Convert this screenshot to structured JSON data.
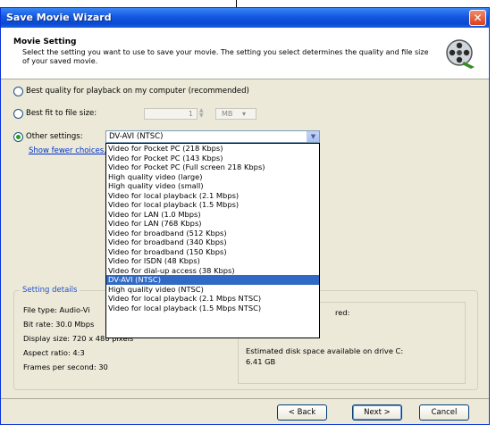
{
  "window": {
    "title": "Save Movie Wizard",
    "close_symbol": "✕"
  },
  "header": {
    "title": "Movie Setting",
    "description": "Select the setting you want to use to save your movie. The setting you select determines the quality and file size of your saved movie."
  },
  "options": {
    "best_quality_label": "Best quality for playback on my computer (recommended)",
    "best_fit_label": "Best fit to file size:",
    "file_size_value": "1",
    "file_size_unit": "MB",
    "other_settings_label": "Other settings:",
    "other_settings_value": "DV-AVI (NTSC)",
    "show_fewer": "Show fewer choices..."
  },
  "dropdown": {
    "items": [
      "Video for Pocket PC (218 Kbps)",
      "Video for Pocket PC (143 Kbps)",
      "Video for Pocket PC (Full screen 218 Kbps)",
      "High quality video (large)",
      "High quality video (small)",
      "Video for local playback (2.1 Mbps)",
      "Video for local playback (1.5 Mbps)",
      "Video for LAN (1.0 Mbps)",
      "Video for LAN (768 Kbps)",
      "Video for broadband (512 Kbps)",
      "Video for broadband (340 Kbps)",
      "Video for broadband (150 Kbps)",
      "Video for ISDN (48 Kbps)",
      "Video for dial-up access (38 Kbps)",
      "DV-AVI (NTSC)",
      "High quality video (NTSC)",
      "Video for local playback (2.1 Mbps NTSC)",
      "Video for local playback (1.5 Mbps NTSC)"
    ],
    "selected_index": 14
  },
  "details": {
    "group_label": "Setting details",
    "file_type": "File type: Audio-Vi",
    "bit_rate": "Bit rate: 30.0 Mbps",
    "display_size": "Display size: 720 x 480 pixels",
    "aspect_ratio": "Aspect ratio: 4:3",
    "fps": "Frames per second: 30",
    "required_partial": "red:",
    "disk_space_label": "Estimated disk space available on drive C:",
    "disk_space_value": "6.41 GB"
  },
  "buttons": {
    "back": "< Back",
    "next": "Next >",
    "cancel": "Cancel"
  },
  "colors": {
    "title_bar": "#0a49d0",
    "selection": "#316ac5",
    "link": "#0033cc"
  }
}
